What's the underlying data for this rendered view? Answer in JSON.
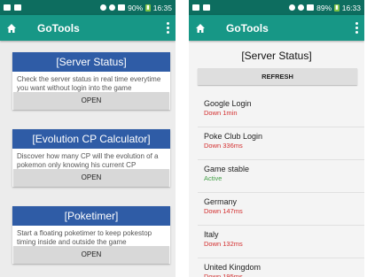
{
  "left": {
    "status": {
      "battery_pct": "90%",
      "time": "16:35"
    },
    "app_title": "GoTools",
    "cards": [
      {
        "title": "[Server Status]",
        "desc": "Check the server status in real time everytime you want without login into the game",
        "button": "OPEN"
      },
      {
        "title": "[Evolution CP Calculator]",
        "desc": "Discover how many CP will the evolution of a pokemon only knowing his current CP",
        "button": "OPEN"
      },
      {
        "title": "[Poketimer]",
        "desc": "Start a floating poketimer to keep pokestop timing inside and outside the game",
        "button": "OPEN"
      }
    ]
  },
  "right": {
    "status": {
      "battery_pct": "89%",
      "time": "16:33"
    },
    "app_title": "GoTools",
    "page_title": "[Server Status]",
    "refresh": "REFRESH",
    "servers": [
      {
        "name": "Google Login",
        "state": "Down 1min",
        "kind": "down"
      },
      {
        "name": "Poke Club Login",
        "state": "Down 336ms",
        "kind": "down"
      },
      {
        "name": "Game stable",
        "state": "Active",
        "kind": "active"
      },
      {
        "name": "Germany",
        "state": "Down 147ms",
        "kind": "down"
      },
      {
        "name": "Italy",
        "state": "Down 132ms",
        "kind": "down"
      },
      {
        "name": "United Kingdom",
        "state": "Down 195ms",
        "kind": "down"
      }
    ]
  },
  "colors": {
    "statusbar": "#0d6d5f",
    "appbar": "#179786",
    "card_header": "#2f5ca6",
    "down": "#d32f2f",
    "active": "#43a047"
  },
  "icons": [
    "home-icon",
    "overflow-menu-icon",
    "wifi-icon",
    "signal-icon",
    "battery-icon"
  ]
}
